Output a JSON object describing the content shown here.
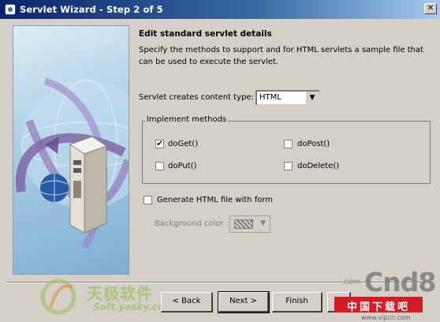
{
  "window": {
    "title": "Servlet Wizard - Step 2 of 5"
  },
  "header": {
    "title": "Edit standard servlet details",
    "description": "Specify the methods to support and for HTML servlets a sample file that can be used to execute the servlet."
  },
  "content_type": {
    "label": "Servlet creates content type:",
    "value": "HTML"
  },
  "methods": {
    "legend": "Implement methods",
    "items": [
      {
        "label": "doGet()",
        "checked": true
      },
      {
        "label": "doPost()",
        "checked": false
      },
      {
        "label": "doPut()",
        "checked": false
      },
      {
        "label": "doDelete()",
        "checked": false
      }
    ]
  },
  "html_form": {
    "label": "Generate HTML file with form",
    "checked": false
  },
  "background": {
    "label": "Background color :"
  },
  "buttons": {
    "back": "< Back",
    "next": "Next >",
    "finish": "Finish"
  },
  "watermarks": {
    "left_chinese": "天极软件",
    "left_url": "Soft.yesky.com",
    "right_brand": "Cnd8",
    "right_com": ".com",
    "right_chinese": "中国下载吧",
    "right_url": "www.vipcn.com"
  },
  "colors": {
    "title_bar": "#0a246a",
    "dialog_bg": "#d4d0c8",
    "watermark_red": "#d21c26",
    "watermark_green": "#9ac264"
  }
}
